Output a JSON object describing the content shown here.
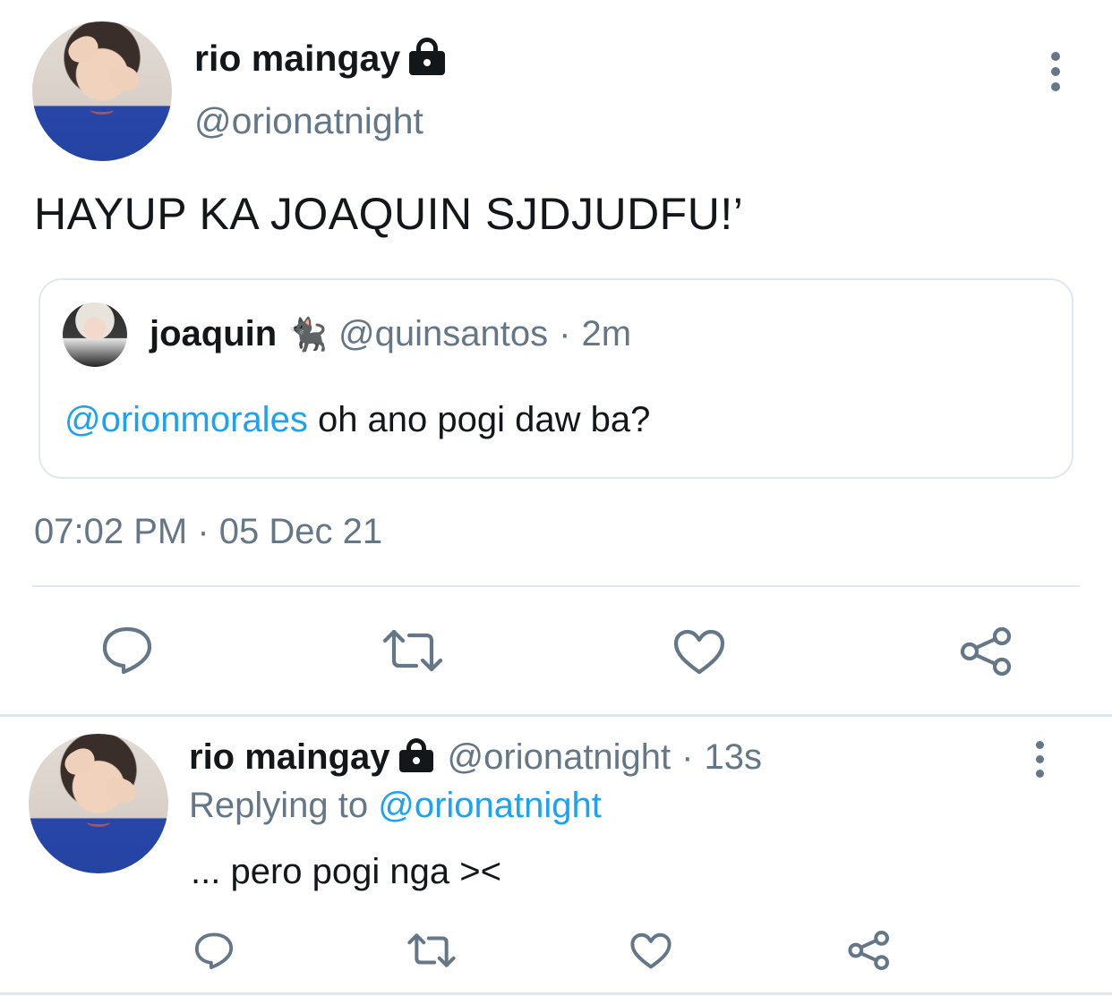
{
  "main_tweet": {
    "display_name": "rio maingay",
    "handle": "@orionatnight",
    "text": "HAYUP KA JOAQUIN SJDJUDFU!’",
    "quote": {
      "display_name": "joaquin",
      "emoji": "🐈‍⬛",
      "handle": "@quinsantos",
      "separator": "·",
      "time": "2m",
      "mention": "@orionmorales",
      "text": " oh ano pogi daw ba?"
    },
    "timestamp": "07:02 PM · 05 Dec 21"
  },
  "reply_tweet": {
    "display_name": "rio maingay",
    "handle": "@orionatnight",
    "separator": "·",
    "time": "13s",
    "replying_label": "Replying to ",
    "replying_mention": "@orionatnight",
    "text": "... pero pogi nga ><"
  },
  "icons": [
    "lock-icon",
    "more-icon",
    "reply-icon",
    "retweet-icon",
    "like-icon",
    "share-icon"
  ],
  "colors": {
    "text": "#14171a",
    "secondary": "#657786",
    "accent": "#1da1f2",
    "border": "#e1e8ed"
  }
}
